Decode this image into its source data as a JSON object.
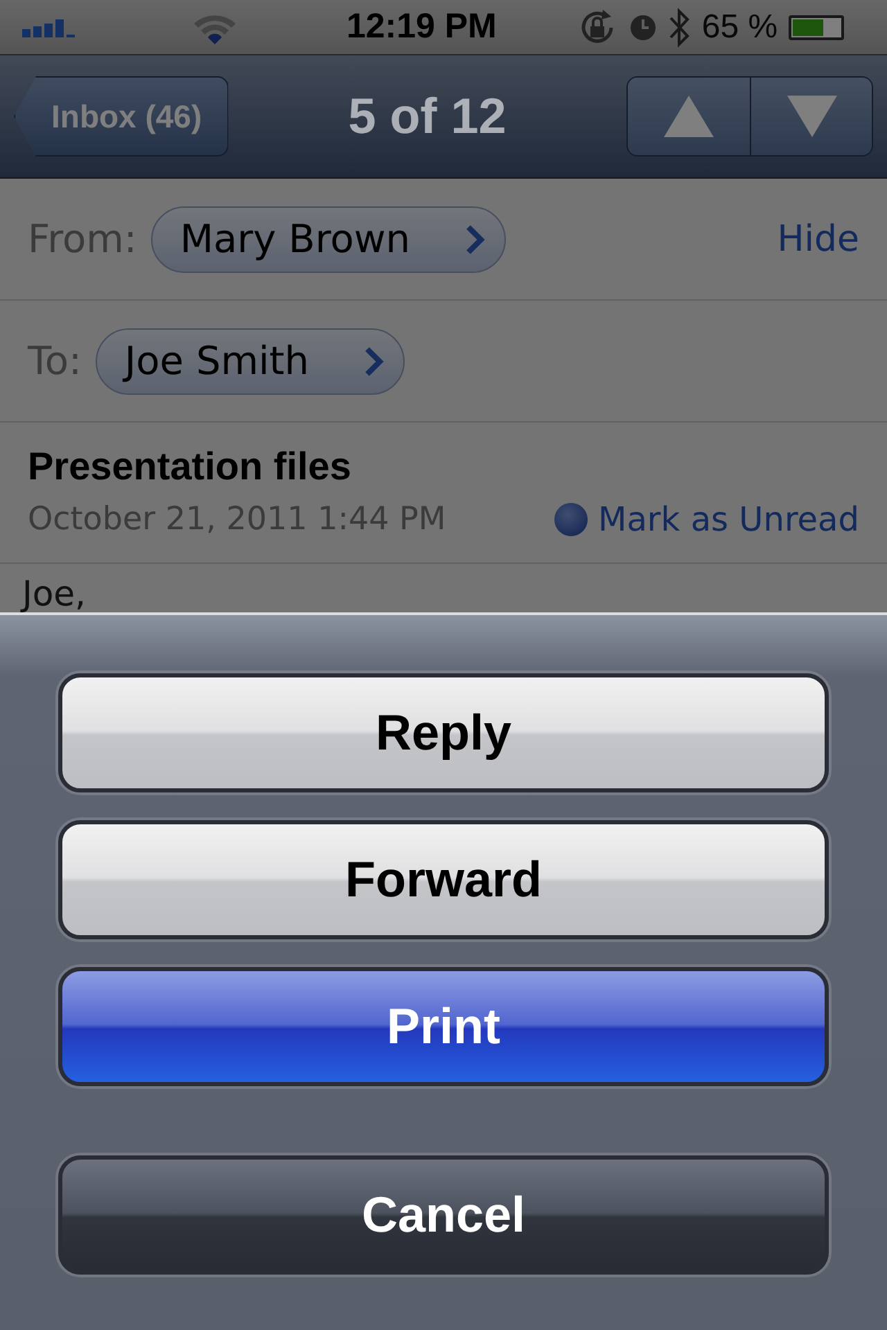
{
  "status_bar": {
    "time": "12:19 PM",
    "battery_text": "65 %",
    "battery": {
      "level": 0.65
    }
  },
  "nav_bar": {
    "back": "Inbox (46)",
    "title": "5 of 12"
  },
  "header": {
    "from_label": "From:",
    "from": "Mary Brown",
    "hide": "Hide",
    "to_label": "To:",
    "to": "Joe Smith",
    "subject": "Presentation files",
    "date": "October 21, 2011 1:44 PM",
    "mark_unread": "Mark as Unread"
  },
  "body": [
    "Joe,"
  ],
  "action_sheet": {
    "buttons": [
      {
        "label": "Reply",
        "kind": "normal"
      },
      {
        "label": "Forward",
        "kind": "normal"
      },
      {
        "label": "Print",
        "kind": "highlight"
      },
      {
        "label": "Cancel",
        "kind": "cancel"
      }
    ]
  }
}
